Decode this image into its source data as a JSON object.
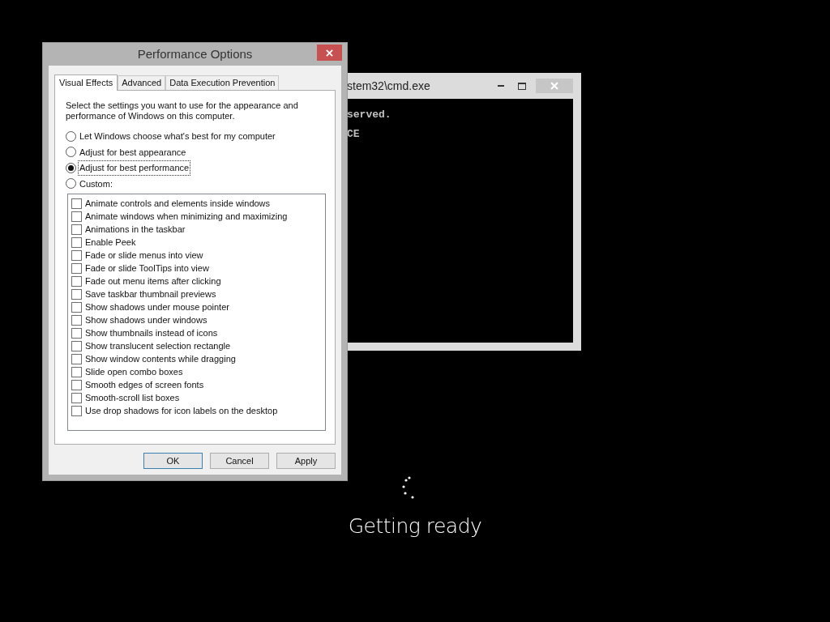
{
  "dialog": {
    "title": "Performance Options",
    "tabs": [
      {
        "label": "Visual Effects",
        "selected": true
      },
      {
        "label": "Advanced",
        "selected": false
      },
      {
        "label": "Data Execution Prevention",
        "selected": false
      }
    ],
    "description": "Select the settings you want to use for the appearance and performance of Windows on this computer.",
    "radios": [
      {
        "label": "Let Windows choose what's best for my computer",
        "selected": false
      },
      {
        "label": "Adjust for best appearance",
        "selected": false
      },
      {
        "label": "Adjust for best performance",
        "selected": true
      },
      {
        "label": "Custom:",
        "selected": false
      }
    ],
    "options": [
      {
        "label": "Animate controls and elements inside windows",
        "checked": false
      },
      {
        "label": "Animate windows when minimizing and maximizing",
        "checked": false
      },
      {
        "label": "Animations in the taskbar",
        "checked": false
      },
      {
        "label": "Enable Peek",
        "checked": false
      },
      {
        "label": "Fade or slide menus into view",
        "checked": false
      },
      {
        "label": "Fade or slide ToolTips into view",
        "checked": false
      },
      {
        "label": "Fade out menu items after clicking",
        "checked": false
      },
      {
        "label": "Save taskbar thumbnail previews",
        "checked": false
      },
      {
        "label": "Show shadows under mouse pointer",
        "checked": false
      },
      {
        "label": "Show shadows under windows",
        "checked": false
      },
      {
        "label": "Show thumbnails instead of icons",
        "checked": false
      },
      {
        "label": "Show translucent selection rectangle",
        "checked": false
      },
      {
        "label": "Show window contents while dragging",
        "checked": false
      },
      {
        "label": "Slide open combo boxes",
        "checked": false
      },
      {
        "label": "Smooth edges of screen fonts",
        "checked": false
      },
      {
        "label": "Smooth-scroll list boxes",
        "checked": false
      },
      {
        "label": "Use drop shadows for icon labels on the desktop",
        "checked": false
      }
    ],
    "buttons": [
      {
        "label": "OK",
        "default": true
      },
      {
        "label": "Cancel",
        "default": false
      },
      {
        "label": "Apply",
        "default": false
      }
    ]
  },
  "console": {
    "title": "stem32\\cmd.exe",
    "lines": [
      "served.",
      "CE"
    ]
  },
  "status": "Getting ready"
}
